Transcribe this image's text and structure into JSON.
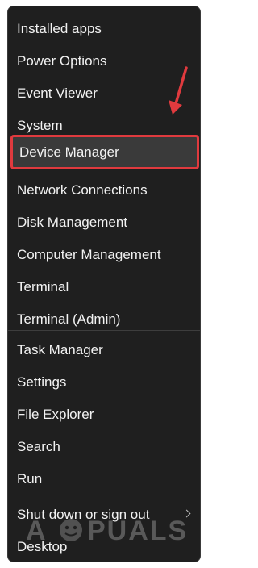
{
  "menu": {
    "items": [
      {
        "label": "Installed apps"
      },
      {
        "label": "Power Options"
      },
      {
        "label": "Event Viewer"
      },
      {
        "label": "System"
      },
      {
        "label": "Device Manager"
      },
      {
        "label": "Network Connections"
      },
      {
        "label": "Disk Management"
      },
      {
        "label": "Computer Management"
      },
      {
        "label": "Terminal"
      },
      {
        "label": "Terminal (Admin)"
      },
      {
        "label": "Task Manager"
      },
      {
        "label": "Settings"
      },
      {
        "label": "File Explorer"
      },
      {
        "label": "Search"
      },
      {
        "label": "Run"
      },
      {
        "label": "Shut down or sign out"
      },
      {
        "label": "Desktop"
      }
    ],
    "highlighted_label": "Device Manager",
    "highlight_color": "#e03a3e",
    "submenu_icon": "chevron-right-icon"
  },
  "annotation": {
    "arrow_color": "#e03a3e",
    "arrow_icon": "arrow-down-icon"
  },
  "watermark": {
    "text": "APPUALS"
  }
}
